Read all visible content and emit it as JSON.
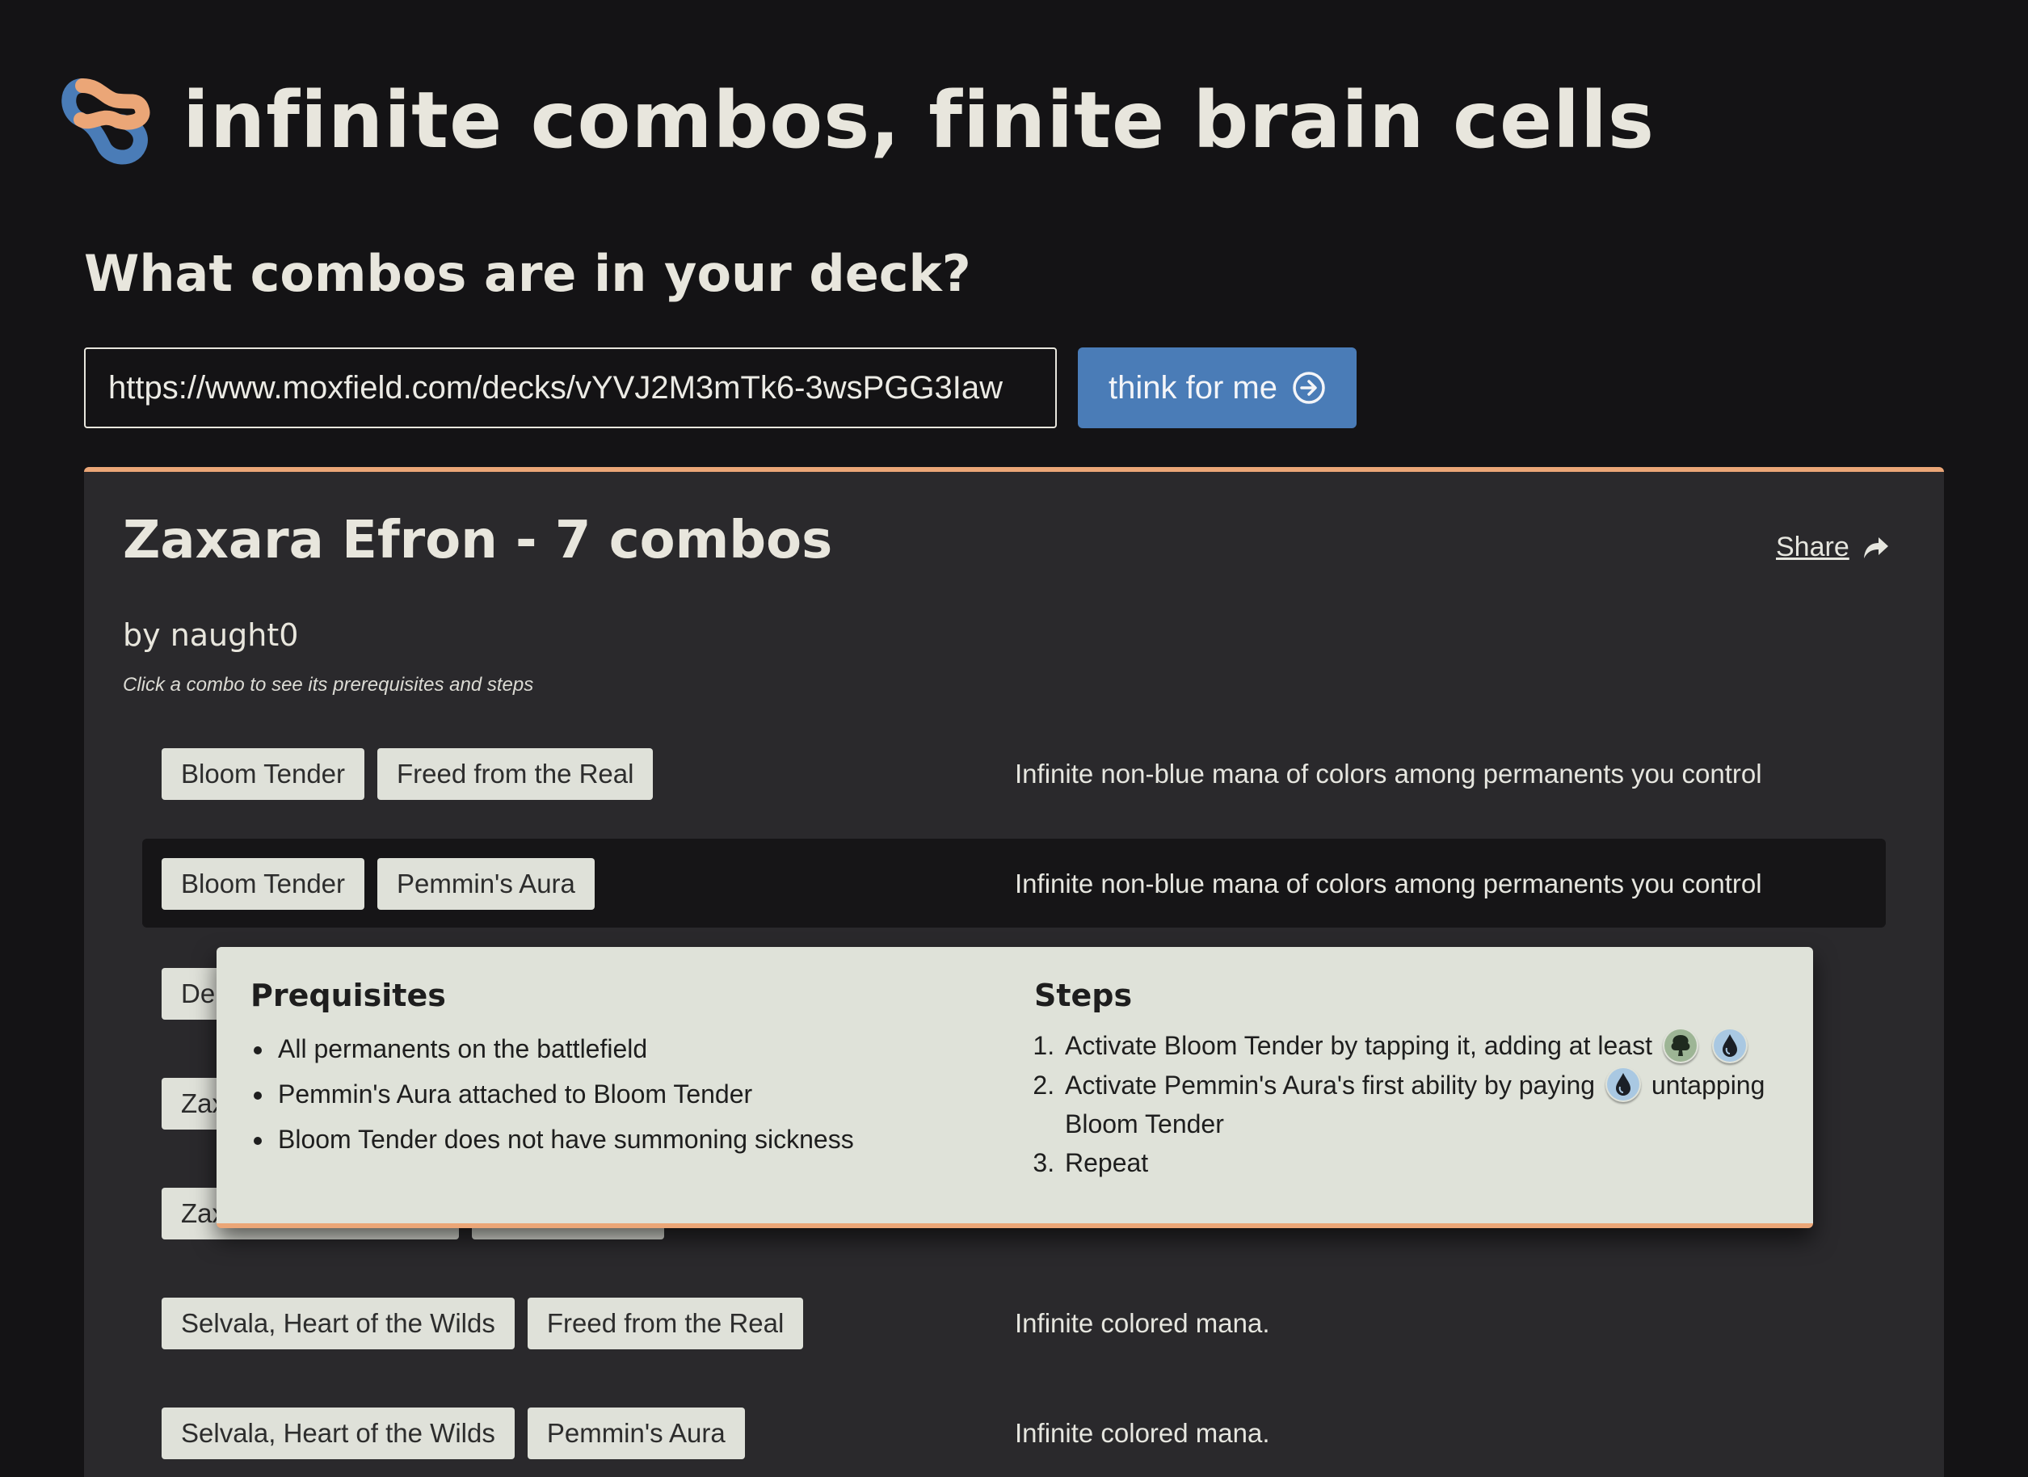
{
  "site": {
    "title": "infinite combos, finite brain cells",
    "logo_colors": {
      "orange": "#eba677",
      "blue": "#4a7cb7"
    }
  },
  "search": {
    "question": "What combos are in your deck?",
    "url_value": "https://www.moxfield.com/decks/vYVJ2M3mTk6-3wsPGG3Iaw",
    "button_label": "think for me",
    "button_icon": "arrow-right-circle-icon"
  },
  "deck": {
    "title": "Zaxara Efron - 7 combos",
    "author": "by naught0",
    "hint": "Click a combo to see its prerequisites and steps",
    "share_label": "Share",
    "share_icon": "share-arrow-icon"
  },
  "combos": [
    {
      "cards": [
        "Bloom Tender",
        "Freed from the Real"
      ],
      "result": "Infinite non-blue mana of colors among permanents you control"
    },
    {
      "cards": [
        "Bloom Tender",
        "Pemmin's Aura"
      ],
      "result": "Infinite non-blue mana of colors among permanents you control",
      "selected": true
    },
    {
      "cards": [
        "Der"
      ],
      "result": ""
    },
    {
      "cards": [
        "Zax"
      ],
      "result": ""
    },
    {
      "cards": [
        "Zax"
      ],
      "result": ""
    },
    {
      "cards": [
        "Selvala, Heart of the Wilds",
        "Freed from the Real"
      ],
      "result": "Infinite colored mana."
    },
    {
      "cards": [
        "Selvala, Heart of the Wilds",
        "Pemmin's Aura"
      ],
      "result": "Infinite colored mana."
    }
  ],
  "popover": {
    "prereq_heading": "Prequisites",
    "prerequisites": [
      "All permanents on the battlefield",
      "Pemmin's Aura attached to Bloom Tender",
      "Bloom Tender does not have summoning sickness"
    ],
    "steps_heading": "Steps",
    "steps": {
      "s1_text": "Activate Bloom Tender by tapping it, adding at least",
      "s1_icons": [
        "green-mana-icon",
        "blue-mana-icon"
      ],
      "s2_text_before": "Activate Pemmin's Aura's first ability by paying",
      "s2_icon": "blue-mana-icon",
      "s2_text_after": "untapping Bloom Tender",
      "s3_text": "Repeat"
    },
    "mana_colors": {
      "green": "#9db595",
      "blue": "#a9c8e2"
    }
  },
  "colors": {
    "background": "#141315",
    "panel": "#2a292c",
    "accent": "#eba677",
    "button": "#4a7cb7",
    "chip": "#dfe1d9",
    "popover": "#dfe2d9"
  }
}
